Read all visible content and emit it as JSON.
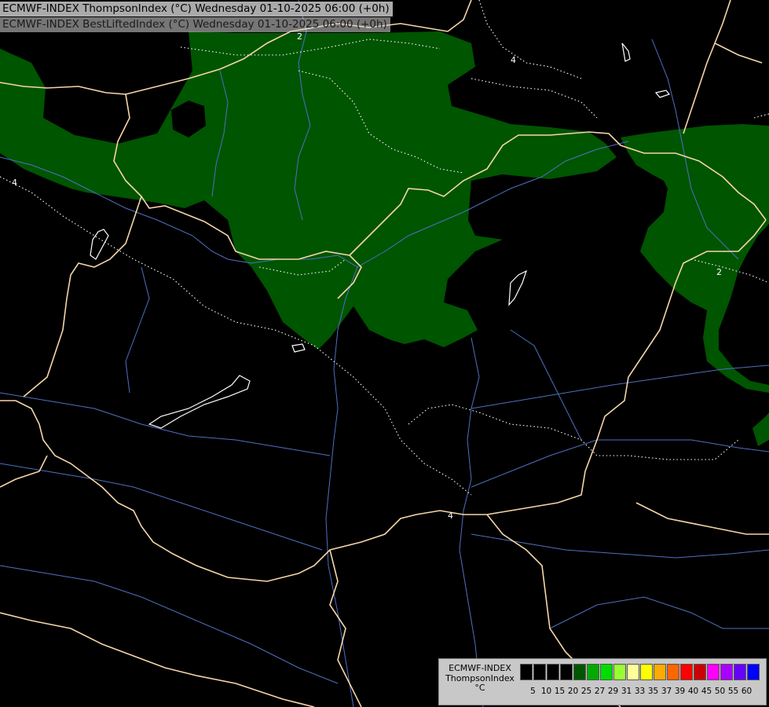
{
  "header": {
    "line1": "ECMWF-INDEX ThompsonIndex (°C) Wednesday 01-10-2025 06:00 (+0h)",
    "line2": "ECMWF-INDEX BestLiftedIndex (°C) Wednesday 01-10-2025 06:00 (+0h)"
  },
  "map": {
    "background_color": "#000000",
    "shade_color": "#005500",
    "border_color": "#f5d6a8",
    "river_color": "#4f6fbf",
    "contour_color": "#ffffff",
    "contour_labels": [
      "4",
      "2",
      "4",
      "2",
      "4"
    ]
  },
  "legend": {
    "title_lines": [
      "ECMWF-INDEX",
      "ThompsonIndex",
      "°C"
    ],
    "ticks": [
      "5",
      "10",
      "15",
      "20",
      "25",
      "27",
      "29",
      "31",
      "33",
      "35",
      "37",
      "39",
      "40",
      "45",
      "50",
      "55",
      "60"
    ],
    "colors": [
      "#000000",
      "#000000",
      "#000000",
      "#000000",
      "#005500",
      "#00aa00",
      "#00dd00",
      "#99ff33",
      "#ffff99",
      "#ffff00",
      "#ffaa00",
      "#ff6600",
      "#ff0000",
      "#cc0000",
      "#ff00ff",
      "#aa00ff",
      "#6600ff",
      "#0000ff"
    ]
  }
}
